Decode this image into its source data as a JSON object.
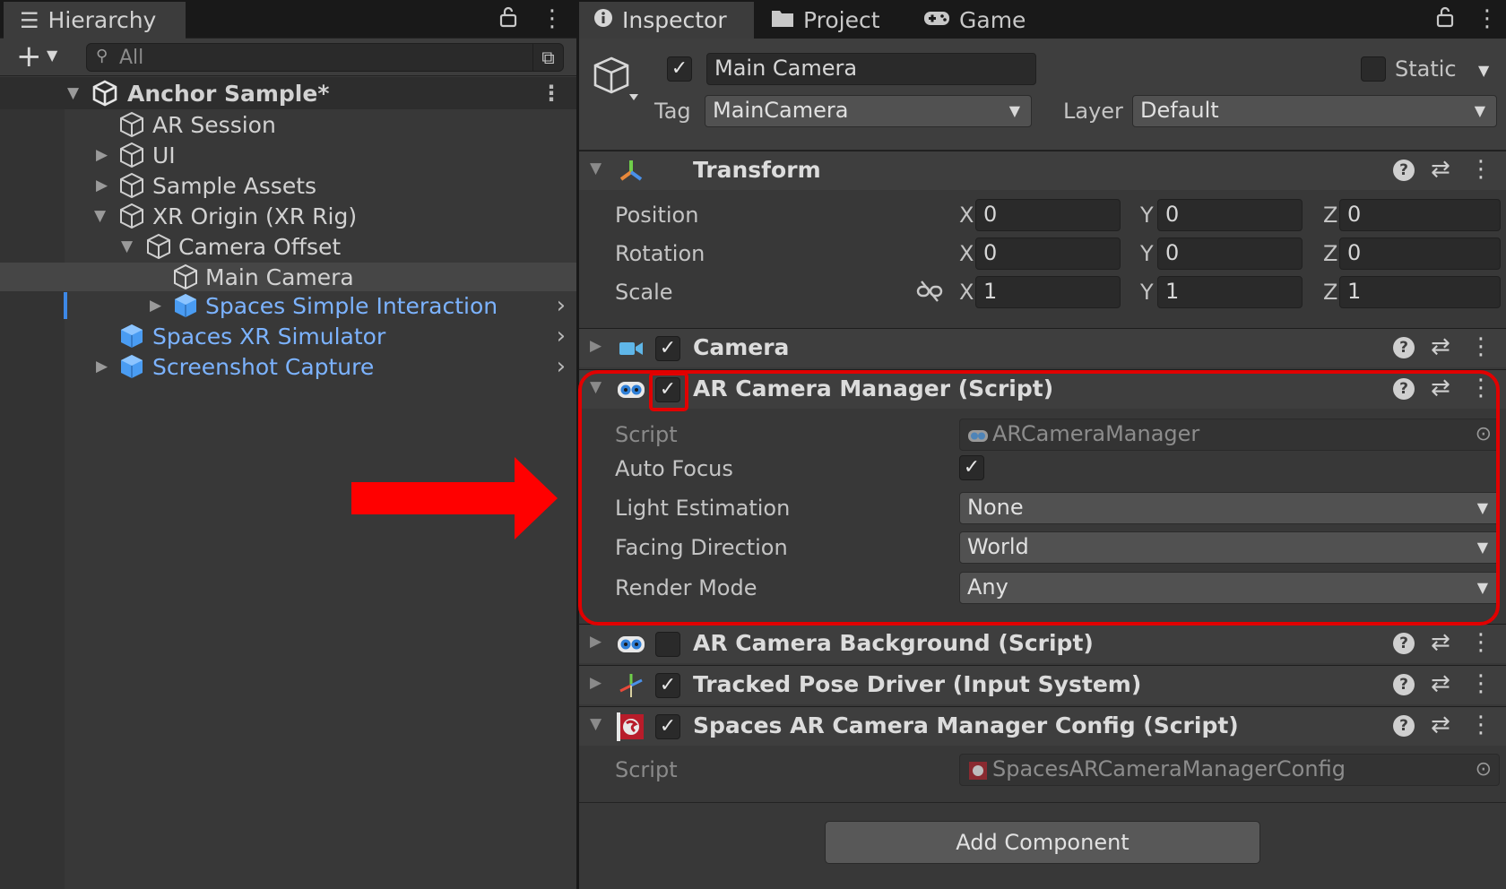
{
  "hierarchy": {
    "tab_label": "Hierarchy",
    "search_placeholder": "All",
    "scene": {
      "label": "Anchor Sample*"
    },
    "items": [
      {
        "label": "AR Session"
      },
      {
        "label": "UI"
      },
      {
        "label": "Sample Assets"
      },
      {
        "label": "XR Origin (XR Rig)"
      },
      {
        "label": "Camera Offset"
      },
      {
        "label": "Main Camera"
      },
      {
        "label": "Spaces Simple Interaction"
      },
      {
        "label": "Spaces XR Simulator"
      },
      {
        "label": "Screenshot Capture"
      }
    ]
  },
  "inspector": {
    "tabs": [
      {
        "label": "Inspector"
      },
      {
        "label": "Project"
      },
      {
        "label": "Game"
      }
    ],
    "object": {
      "name": "Main Camera",
      "static_label": "Static",
      "tag_label": "Tag",
      "tag_value": "MainCamera",
      "layer_label": "Layer",
      "layer_value": "Default"
    },
    "transform": {
      "title": "Transform",
      "position_label": "Position",
      "rotation_label": "Rotation",
      "scale_label": "Scale",
      "axis_x": "X",
      "axis_y": "Y",
      "axis_z": "Z",
      "position": {
        "x": "0",
        "y": "0",
        "z": "0"
      },
      "rotation": {
        "x": "0",
        "y": "0",
        "z": "0"
      },
      "scale": {
        "x": "1",
        "y": "1",
        "z": "1"
      }
    },
    "camera": {
      "title": "Camera"
    },
    "ar_camera_manager": {
      "title": "AR Camera Manager (Script)",
      "script_label": "Script",
      "script_value": "ARCameraManager",
      "auto_focus_label": "Auto Focus",
      "light_estimation_label": "Light Estimation",
      "light_estimation_value": "None",
      "facing_direction_label": "Facing Direction",
      "facing_direction_value": "World",
      "render_mode_label": "Render Mode",
      "render_mode_value": "Any"
    },
    "ar_camera_background": {
      "title": "AR Camera Background (Script)"
    },
    "tracked_pose_driver": {
      "title": "Tracked Pose Driver (Input System)"
    },
    "spaces_config": {
      "title": "Spaces AR Camera Manager Config (Script)",
      "script_label": "Script",
      "script_value": "SpacesARCameraManagerConfig"
    },
    "add_component_label": "Add Component"
  },
  "colors": {
    "prefab_text": "#7cb3ff",
    "highlight": "#e10000",
    "panel_bg": "#383838"
  }
}
